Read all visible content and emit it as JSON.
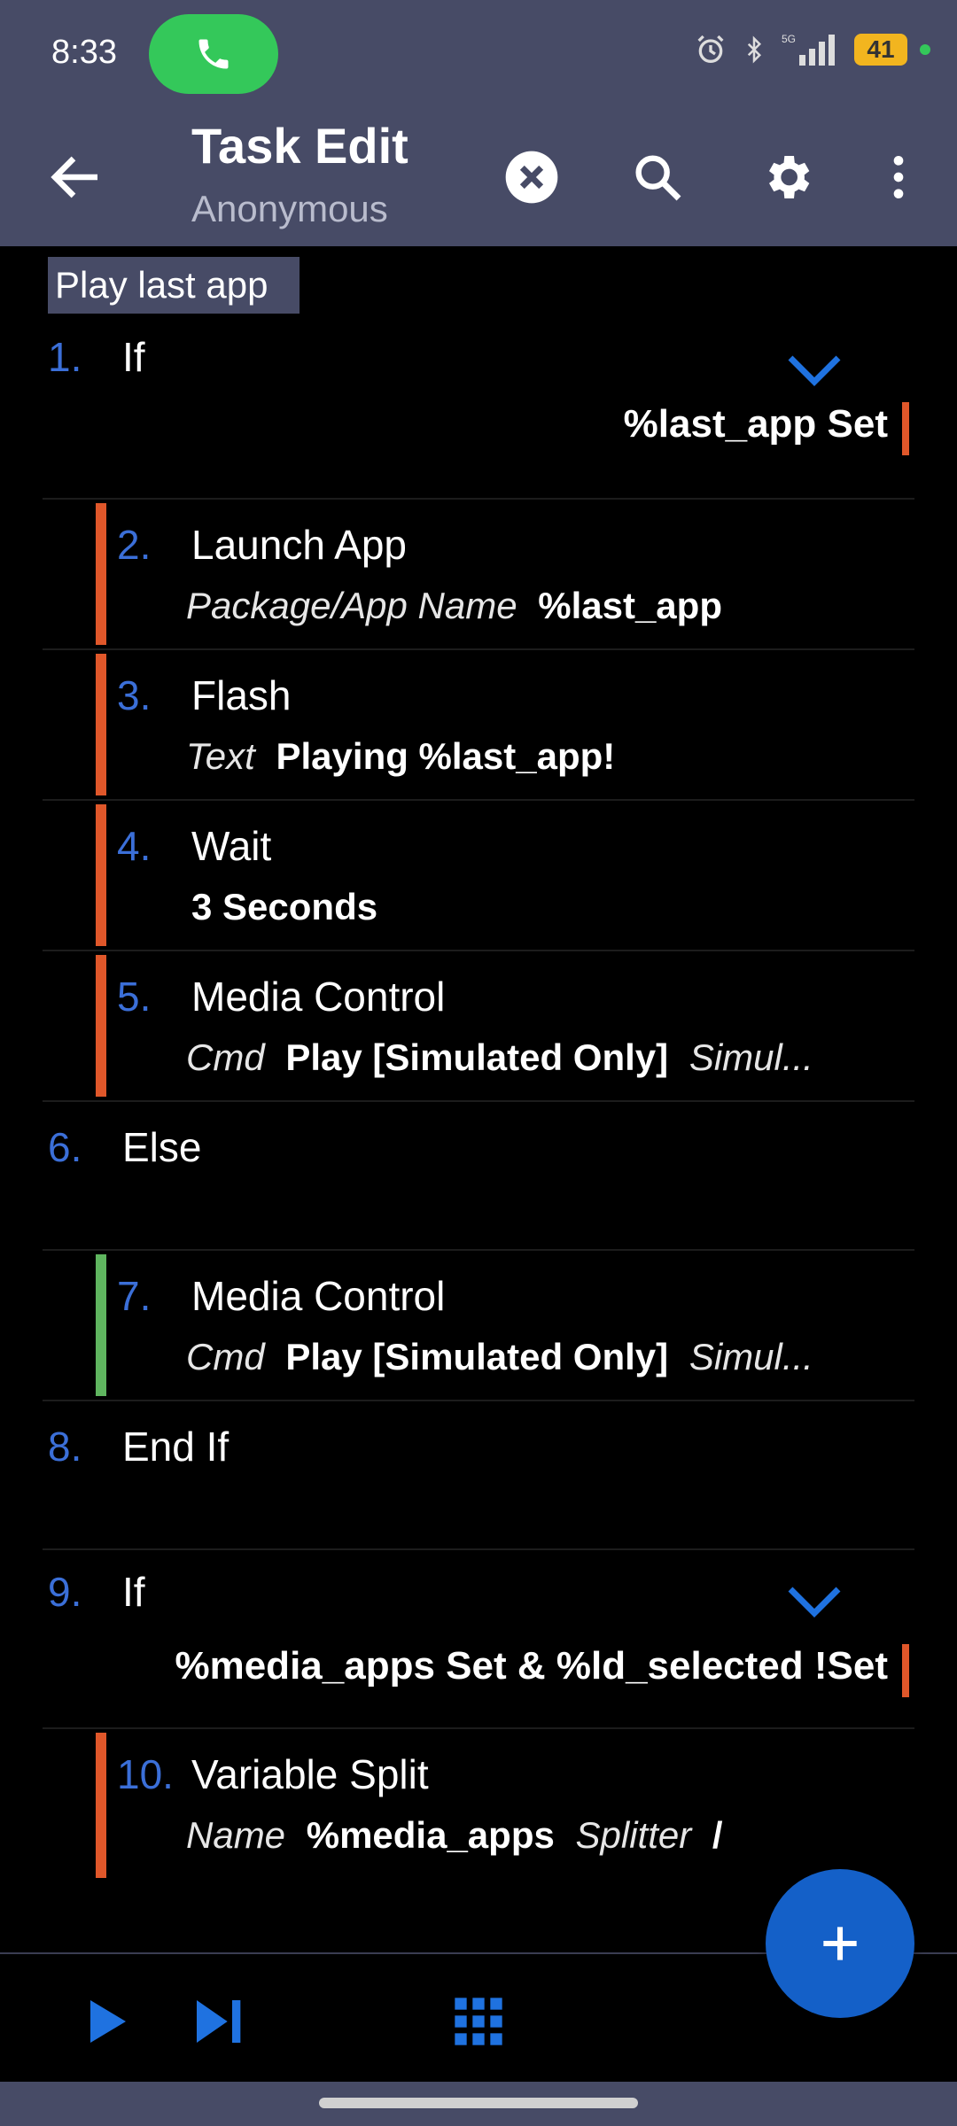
{
  "status_bar": {
    "time": "8:33",
    "battery": "41",
    "icons": [
      "phone-icon",
      "alarm-icon",
      "bluetooth-icon",
      "5g-icon",
      "signal-icon",
      "battery-icon"
    ]
  },
  "app_bar": {
    "title": "Task Edit",
    "subtitle": "Anonymous",
    "icons": [
      "back-arrow-icon",
      "clear-icon",
      "search-icon",
      "gear-icon",
      "more-vert-icon"
    ]
  },
  "task": {
    "name": "Play last app",
    "actions": [
      {
        "num": "1.",
        "label": "If",
        "condition": "%last_app Set"
      },
      {
        "num": "2.",
        "label": "Launch App",
        "arg_key": "Package/App Name",
        "arg_value": "%last_app"
      },
      {
        "num": "3.",
        "label": "Flash",
        "arg_key": "Text",
        "arg_value": "Playing %last_app!"
      },
      {
        "num": "4.",
        "label": "Wait",
        "arg_value": "3 Seconds"
      },
      {
        "num": "5.",
        "label": "Media Control",
        "arg_key": "Cmd",
        "arg_value": "Play [Simulated Only]",
        "arg_extra": "Simul..."
      },
      {
        "num": "6.",
        "label": "Else"
      },
      {
        "num": "7.",
        "label": "Media Control",
        "arg_key": "Cmd",
        "arg_value": "Play [Simulated Only]",
        "arg_extra": "Simul..."
      },
      {
        "num": "8.",
        "label": "End If"
      },
      {
        "num": "9.",
        "label": "If",
        "condition": "%media_apps Set & %ld_selected !Set"
      },
      {
        "num": "10.",
        "label": "Variable Split",
        "arg_key": "Name",
        "arg_value": "%media_apps",
        "arg_key2": "Splitter",
        "arg_value2": "/"
      }
    ]
  },
  "colors": {
    "accent_blue": "#3b6fd8",
    "branch_orange": "#e0572a",
    "branch_green": "#5fb55f",
    "header_bg": "#474b66",
    "fab_blue": "#1460c8"
  },
  "bottom_bar": {
    "icons": [
      "play-icon",
      "skip-next-icon",
      "grid-icon"
    ]
  },
  "fab": {
    "icon": "plus-icon"
  }
}
